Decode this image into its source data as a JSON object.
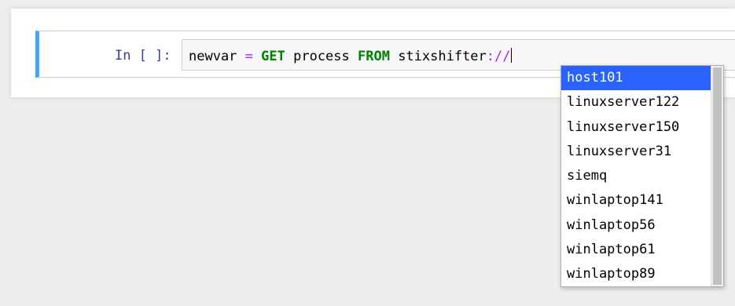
{
  "cell": {
    "prompt": "In [ ]:",
    "code": {
      "var": "newvar ",
      "eq": "=",
      "sp1": " ",
      "get": "GET",
      "mid": " process ",
      "from": "FROM",
      "src": " stixshifter",
      "sep": "://"
    }
  },
  "completion": {
    "selected_index": 0,
    "items": [
      "host101",
      "linuxserver122",
      "linuxserver150",
      "linuxserver31",
      "siemq",
      "winlaptop141",
      "winlaptop56",
      "winlaptop61",
      "winlaptop89"
    ]
  },
  "colors": {
    "accent_border": "#42a5f5",
    "selection": "#2962ff",
    "prompt": "#303f9f",
    "keyword": "#008000",
    "operator": "#aa22ff"
  }
}
